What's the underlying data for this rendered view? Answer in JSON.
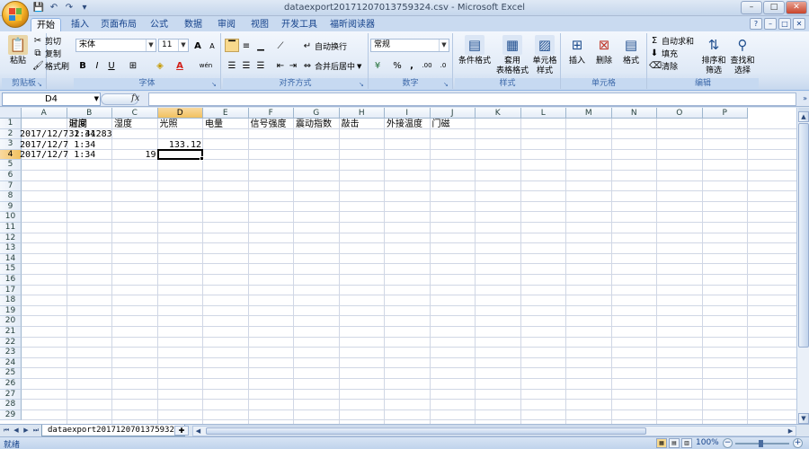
{
  "window": {
    "title": "dataexport20171207013759324.csv - Microsoft Excel",
    "controls": [
      "–",
      "□",
      "✕"
    ]
  },
  "qat": [
    "💾",
    "↶",
    "↷",
    "▾"
  ],
  "ribbon_tabs": [
    "开始",
    "插入",
    "页面布局",
    "公式",
    "数据",
    "审阅",
    "视图",
    "开发工具",
    "福昕阅读器"
  ],
  "ribbon": {
    "clipboard": {
      "paste": "粘贴",
      "cut": "剪切",
      "copy": "复制",
      "format_painter": "格式刷",
      "label": "剪贴板"
    },
    "font": {
      "name": "宋体",
      "size": "11",
      "bold": "B",
      "italic": "I",
      "underline": "U",
      "grow": "A",
      "shrink": "A",
      "wen": "wén",
      "label": "字体"
    },
    "alignment": {
      "wrap": "自动换行",
      "merge": "合并后居中",
      "label": "对齐方式"
    },
    "number": {
      "format": "常规",
      "percent": "%",
      "comma": ",",
      "inc_dec": ".00",
      "dec_dec": ".0",
      "label": "数字"
    },
    "styles": {
      "cond": "条件格式",
      "table_fmt_1": "套用",
      "table_fmt_2": "表格格式",
      "cell_style_1": "单元格",
      "cell_style_2": "样式",
      "label": "样式"
    },
    "cells": {
      "insert": "插入",
      "delete": "删除",
      "format": "格式",
      "label": "单元格"
    },
    "editing": {
      "autosum": "自动求和",
      "fill": "填充",
      "clear": "清除",
      "sort_1": "排序和",
      "sort_2": "筛选",
      "find_1": "查找和",
      "find_2": "选择",
      "label": "编辑"
    }
  },
  "formula_bar": {
    "name_box": "D4",
    "fx": "fx",
    "value": ""
  },
  "columns": [
    "A",
    "B",
    "C",
    "D",
    "E",
    "F",
    "G",
    "H",
    "I",
    "J",
    "K",
    "L",
    "M",
    "N",
    "O",
    "P"
  ],
  "rows": [
    "1",
    "2",
    "3",
    "4",
    "5",
    "6",
    "7",
    "8",
    "9",
    "10",
    "11",
    "12",
    "13",
    "14",
    "15",
    "16",
    "17",
    "18",
    "19",
    "20",
    "21",
    "22",
    "23",
    "24",
    "25",
    "26",
    "27",
    "28",
    "29"
  ],
  "selected_cell": "D4",
  "cells": {
    "A1": "时间",
    "B1": "温度",
    "C1": "湿度",
    "D1": "光照",
    "E1": "电量",
    "F1": "信号强度",
    "G1": "震动指数",
    "H1": "敲击",
    "I1": "外接温度",
    "J1": "门磁",
    "A2": "2017/12/7 1:34",
    "B2": "32.41283",
    "A3": "2017/12/7 1:34",
    "D3": "133.12",
    "A4": "2017/12/7 1:34",
    "C4": "19"
  },
  "sheet_tabs": [
    "dataexport20171207013759324"
  ],
  "status": {
    "mode": "就绪",
    "zoom": "100%"
  }
}
